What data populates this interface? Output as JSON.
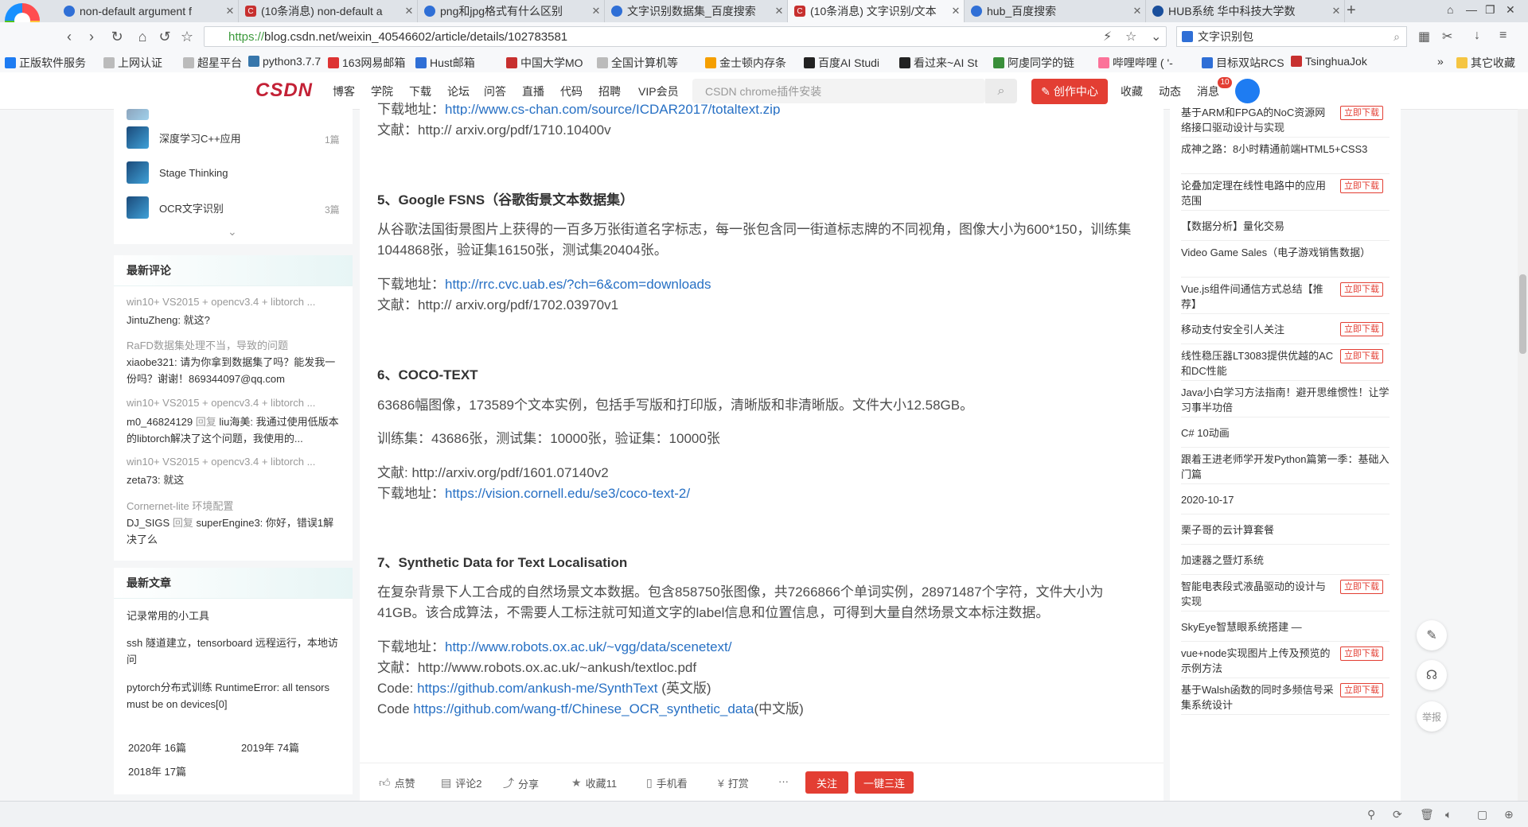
{
  "tabs": [
    {
      "title": "non-default argument f",
      "icon": "paw-icon",
      "active": false
    },
    {
      "title": "(10条消息) non-default a",
      "icon": "csdn-icon",
      "active": false
    },
    {
      "title": "png和jpg格式有什么区别",
      "icon": "paw-icon",
      "active": false
    },
    {
      "title": "文字识别数据集_百度搜索",
      "icon": "paw-icon",
      "active": false
    },
    {
      "title": "(10条消息) 文字识别/文本",
      "icon": "csdn-icon",
      "active": true
    },
    {
      "title": "hub_百度搜索",
      "icon": "paw-icon",
      "active": false
    },
    {
      "title": "HUB系统 华中科技大学数",
      "icon": "hub-icon",
      "active": false
    }
  ],
  "address": {
    "scheme": "https://",
    "domain": "blog.csdn.net",
    "path": "/weixin_40546602/article/details/102783581"
  },
  "search_box": {
    "value": "文字识别包"
  },
  "bookmarks": [
    "正版软件服务",
    "上网认证",
    "超星平台",
    "python3.7.7",
    "163网易邮箱",
    "Hust邮箱",
    "中国大学MO",
    "全国计算机等",
    "金士顿内存条",
    "百度AI Studi",
    "看过来~AI St",
    "阿虔同学的链",
    "哔哩哔哩 ( '-",
    "目标双站RCS",
    "TsinghuaJok",
    "其它收藏"
  ],
  "csdn_header": {
    "logo": "CSDN",
    "nav": [
      "博客",
      "学院",
      "下载",
      "论坛",
      "问答",
      "直播",
      "代码",
      "招聘",
      "VIP会员"
    ],
    "search_placeholder": "CSDN chrome插件安装",
    "create_label": "创作中心",
    "right": [
      "收藏",
      "动态",
      "消息"
    ],
    "msg_count": "10"
  },
  "sidebar": {
    "columns": [
      {
        "name": "深度学习C++应用",
        "count": "1篇"
      },
      {
        "name": "Stage Thinking",
        "count": ""
      },
      {
        "name": "OCR文字识别",
        "count": "3篇"
      }
    ],
    "comments_title": "最新评论",
    "comments": [
      {
        "title": "win10+ VS2015 + opencv3.4 + libtorch ...",
        "user": "JintuZheng:",
        "reply": "",
        "text": "就这?"
      },
      {
        "title": "RaFD数据集处理不当，导致的问题",
        "user": "xiaobe321:",
        "reply": "",
        "text": "请为你拿到数据集了吗？能发我一份吗？谢谢！869344097@qq.com"
      },
      {
        "title": "win10+ VS2015 + opencv3.4 + libtorch ...",
        "user": "m0_46824129",
        "reply": "回复",
        "text": "liu海美: 我通过使用低版本的libtorch解决了这个问题，我使用的..."
      },
      {
        "title": "win10+ VS2015 + opencv3.4 + libtorch ...",
        "user": "zeta73:",
        "reply": "",
        "text": "就这"
      },
      {
        "title": "Cornernet-lite 环境配置",
        "user": "DJ_SIGS",
        "reply": "回复",
        "text": "superEngine3: 你好，错误1解决了么"
      }
    ],
    "articles_title": "最新文章",
    "articles": [
      "记录常用的小工具",
      "ssh 隧道建立，tensorboard 远程运行，本地访问",
      "pytorch分布式训练 RuntimeError: all tensors must be on devices[0]"
    ],
    "archive": [
      "2020年 16篇",
      "2019年 74篇",
      "2018年 17篇"
    ]
  },
  "article": {
    "top_link_partial": "http://www.cs-chan.com/source/ICDAR2017/totaltext.zip",
    "top_download_label": "下载地址：",
    "top_paper": "文献：http:// arxiv.org/pdf/1710.10400v",
    "sections": [
      {
        "heading": "5、Google FSNS（谷歌街景文本数据集）",
        "desc": "从谷歌法国街景图片上获得的一百多万张街道名字标志，每一张包含同一街道标志牌的不同视角，图像大小为600*150，训练集1044868张，验证集16150张，测试集20404张。",
        "download_label": "下载地址：",
        "download_link": "http://rrc.cvc.uab.es/?ch=6&com=downloads",
        "paper": "文献：http:// arxiv.org/pdf/1702.03970v1"
      },
      {
        "heading": "6、COCO-TEXT",
        "desc": "63686幅图像，173589个文本实例，包括手写版和打印版，清晰版和非清晰版。文件大小12.58GB。",
        "desc2": "训练集：43686张，测试集：10000张，验证集：10000张",
        "paper": "文献: http://arxiv.org/pdf/1601.07140v2",
        "download_label": "下载地址：",
        "download_link": "https://vision.cornell.edu/se3/coco-text-2/"
      },
      {
        "heading": "7、Synthetic Data for Text Localisation",
        "desc": "在复杂背景下人工合成的自然场景文本数据。包含858750张图像，共7266866个单词实例，28971487个字符，文件大小为41GB。该合成算法，不需要人工标注就可知道文字的label信息和位置信息，可得到大量自然场景文本标注数据。",
        "download_label": "下载地址：",
        "download_link": "http://www.robots.ox.ac.uk/~vgg/data/scenetext/",
        "paper": "文献：http://www.robots.ox.ac.uk/~ankush/textloc.pdf",
        "code1_label": "Code:",
        "code1_link": "https://github.com/ankush-me/SynthText",
        "code1_suffix": "(英文版)",
        "code2_label": "Code",
        "code2_link": "https://github.com/wang-tf/Chinese_OCR_synthetic_data",
        "code2_suffix": "(中文版)"
      }
    ]
  },
  "toolbar": {
    "like": "点赞",
    "comment": "评论2",
    "share": "分享",
    "collect": "收藏11",
    "mobile": "手机看",
    "reward": "打赏",
    "more": "···",
    "follow": "关注",
    "triple": "一键三连"
  },
  "right_list": [
    {
      "text": "基于ARM和FPGA的NoC资源网络接口驱动设计与实现",
      "dl": true
    },
    {
      "text": "成神之路：8小时精通前端HTML5+CSS3",
      "dl": false
    },
    {
      "text": "论叠加定理在线性电路中的应用范围",
      "dl": true
    },
    {
      "text": "【数据分析】量化交易",
      "dl": false
    },
    {
      "text": "Video Game Sales（电子游戏销售数据）",
      "dl": false
    },
    {
      "text": "Vue.js组件间通信方式总结【推荐】",
      "dl": true
    },
    {
      "text": "移动支付安全引人关注",
      "dl": true
    },
    {
      "text": "线性稳压器LT3083提供优越的AC和DC性能",
      "dl": true
    },
    {
      "text": "Java小白学习方法指南！避开思维惯性！让学习事半功倍",
      "dl": false
    },
    {
      "text": "C# 10动画",
      "dl": false
    },
    {
      "text": "跟着王进老师学开发Python篇第一季：基础入门篇",
      "dl": false
    },
    {
      "text": "2020-10-17",
      "dl": false
    },
    {
      "text": "栗子哥的云计算套餐",
      "dl": false
    },
    {
      "text": "加速器之暨灯系统",
      "dl": false
    },
    {
      "text": "智能电表段式液晶驱动的设计与实现",
      "dl": true
    },
    {
      "text": "SkyEye智慧眼系统搭建 —",
      "dl": false
    },
    {
      "text": "vue+node实现图片上传及预览的示例方法",
      "dl": true
    },
    {
      "text": "基于Walsh函数的同时多频信号采集系统设计",
      "dl": true
    }
  ],
  "right_dl_label": "立即下载",
  "floating": {
    "report": "举报"
  }
}
